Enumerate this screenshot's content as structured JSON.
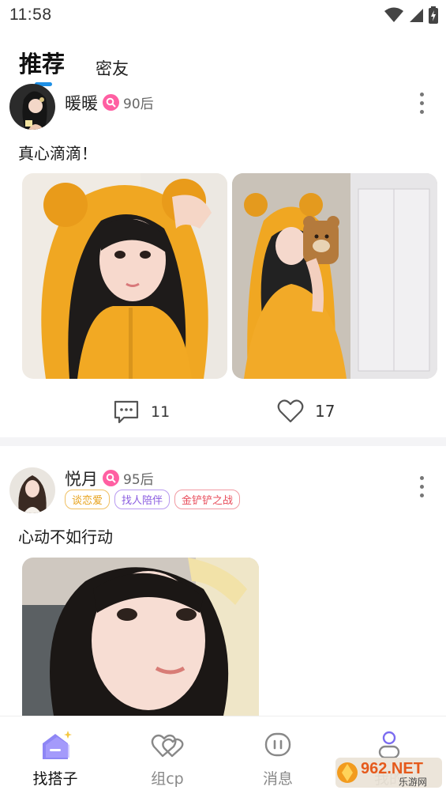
{
  "status_bar": {
    "time": "11:58",
    "icons": [
      "wifi-icon",
      "signal-icon",
      "battery-icon"
    ]
  },
  "tabs": [
    {
      "label": "推荐",
      "active": true
    },
    {
      "label": "密友",
      "active": false
    }
  ],
  "posts": [
    {
      "username": "暖暖",
      "age": "90后",
      "tags": [],
      "text": "真心滴滴！",
      "comments": "11",
      "likes": "17"
    },
    {
      "username": "悦月",
      "age": "95后",
      "tags": [
        "谈恋爱",
        "找人陪伴",
        "金铲铲之战"
      ],
      "text": "心动不如行动"
    }
  ],
  "bottom_nav": [
    {
      "label": "找搭子",
      "icon": "home-badge-icon",
      "active": true
    },
    {
      "label": "组cp",
      "icon": "couple-hearts-icon",
      "active": false
    },
    {
      "label": "消息",
      "icon": "message-icon",
      "active": false
    },
    {
      "label": "我的",
      "icon": "profile-icon",
      "active": false
    }
  ],
  "watermark": {
    "brand": "962.NET",
    "sub": "乐游网"
  },
  "colors": {
    "accent_blue": "#1e90e6",
    "badge_pink": "#ff5fa2",
    "nav_purple": "#7b6cf0"
  }
}
